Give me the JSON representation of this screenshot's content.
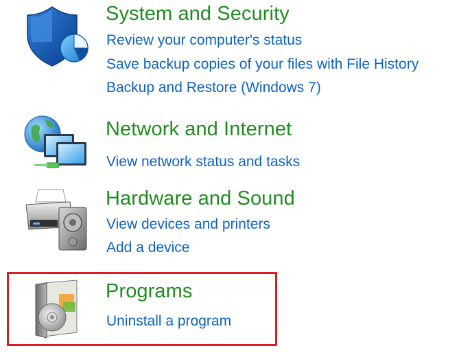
{
  "categories": [
    {
      "id": "system-and-security",
      "title": "System and Security",
      "icon": "shield-icon",
      "links": [
        "Review your computer's status",
        "Save backup copies of your files with File History",
        "Backup and Restore (Windows 7)"
      ]
    },
    {
      "id": "network-and-internet",
      "title": "Network and Internet",
      "icon": "network-globe-icon",
      "links": [
        "View network status and tasks"
      ]
    },
    {
      "id": "hardware-and-sound",
      "title": "Hardware and Sound",
      "icon": "printer-speaker-icon",
      "links": [
        "View devices and printers",
        "Add a device"
      ]
    },
    {
      "id": "programs",
      "title": "Programs",
      "icon": "programs-disc-icon",
      "links": [
        "Uninstall a program"
      ]
    }
  ],
  "colors": {
    "title_green": "#1e8c1e",
    "link_blue": "#0c63c4",
    "highlight_red": "#e01b24"
  }
}
